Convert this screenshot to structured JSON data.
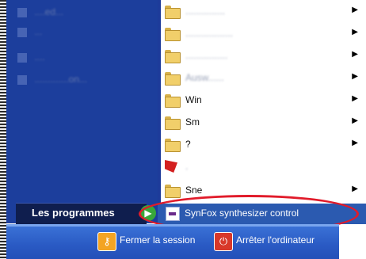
{
  "left_panel": {
    "items": [
      {
        "label": "....ed..."
      },
      {
        "label": "..."
      },
      {
        "label": "...."
      },
      {
        "label": ".............on..."
      }
    ],
    "all_programs_label": "Les programmes",
    "all_programs_arrow": "▶"
  },
  "submenu": {
    "items": [
      {
        "label": "...............",
        "has_arrow": true
      },
      {
        "label": "..................",
        "has_arrow": true
      },
      {
        "label": "................",
        "has_arrow": true
      },
      {
        "label": "Ausw......",
        "has_arrow": true
      },
      {
        "label": "Win",
        "has_arrow": true
      },
      {
        "label": "Sm",
        "has_arrow": true
      },
      {
        "label": "?",
        "has_arrow": true
      },
      {
        "label": ".",
        "has_arrow": false
      },
      {
        "label": "Sne",
        "has_arrow": true
      }
    ],
    "submenu_arrow": "▶",
    "selected_item": "SynFox synthesizer control"
  },
  "bottom_bar": {
    "logoff_label": "Fermer la session",
    "shutdown_label": "Arrêter l'ordinateur",
    "logoff_icon": "key-icon",
    "shutdown_icon": "power-icon"
  },
  "annotation": {
    "color": "#e11b2a"
  }
}
